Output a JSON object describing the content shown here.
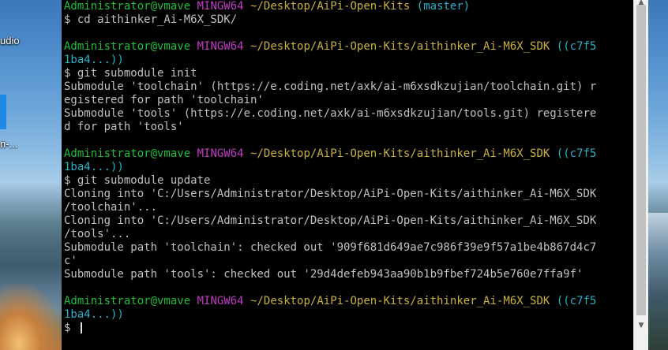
{
  "desktop": {
    "icon_labels": [
      "udio",
      "n-..."
    ]
  },
  "terminal": {
    "lines": [
      {
        "type": "prompt",
        "user": "Administrator@vmave",
        "env": "MINGW64",
        "path": "~/Desktop/AiPi-Open-Kits",
        "branch": "(master)"
      },
      {
        "type": "text",
        "text": "$ cd aithinker_Ai-M6X_SDK/"
      },
      {
        "type": "blank",
        "text": ""
      },
      {
        "type": "prompt",
        "user": "Administrator@vmave",
        "env": "MINGW64",
        "path": "~/Desktop/AiPi-Open-Kits/aithinker_Ai-M6X_SDK",
        "branch": "((c7f5"
      },
      {
        "type": "branchcont",
        "text": "1ba4...))"
      },
      {
        "type": "text",
        "text": "$ git submodule init"
      },
      {
        "type": "text",
        "text": "Submodule 'toolchain' (https://e.coding.net/axk/ai-m6xsdkzujian/toolchain.git) r"
      },
      {
        "type": "text",
        "text": "egistered for path 'toolchain'"
      },
      {
        "type": "text",
        "text": "Submodule 'tools' (https://e.coding.net/axk/ai-m6xsdkzujian/tools.git) registere"
      },
      {
        "type": "text",
        "text": "d for path 'tools'"
      },
      {
        "type": "blank",
        "text": ""
      },
      {
        "type": "prompt",
        "user": "Administrator@vmave",
        "env": "MINGW64",
        "path": "~/Desktop/AiPi-Open-Kits/aithinker_Ai-M6X_SDK",
        "branch": "((c7f5"
      },
      {
        "type": "branchcont",
        "text": "1ba4...))"
      },
      {
        "type": "text",
        "text": "$ git submodule update"
      },
      {
        "type": "text",
        "text": "Cloning into 'C:/Users/Administrator/Desktop/AiPi-Open-Kits/aithinker_Ai-M6X_SDK"
      },
      {
        "type": "text",
        "text": "/toolchain'..."
      },
      {
        "type": "text",
        "text": "Cloning into 'C:/Users/Administrator/Desktop/AiPi-Open-Kits/aithinker_Ai-M6X_SDK"
      },
      {
        "type": "text",
        "text": "/tools'..."
      },
      {
        "type": "text",
        "text": "Submodule path 'toolchain': checked out '909f681d649ae7c986f39e9f57a1be4b867d4c7"
      },
      {
        "type": "text",
        "text": "c'"
      },
      {
        "type": "text",
        "text": "Submodule path 'tools': checked out '29d4defeb943aa90b1b9fbef724b5e760e7ffa9f'"
      },
      {
        "type": "blank",
        "text": ""
      },
      {
        "type": "prompt",
        "user": "Administrator@vmave",
        "env": "MINGW64",
        "path": "~/Desktop/AiPi-Open-Kits/aithinker_Ai-M6X_SDK",
        "branch": "((c7f5"
      },
      {
        "type": "branchcont",
        "text": "1ba4...))"
      },
      {
        "type": "input",
        "text": "$ "
      }
    ]
  },
  "colors": {
    "terminal_bg": "#000000",
    "text": "#c0c0c0",
    "user": "#1fbf3a",
    "mingw": "#c23cc2",
    "path": "#c9b13b",
    "branch": "#2ab0c8"
  },
  "scrollbar": {
    "up_icon": "triangle-up-icon",
    "down_icon": "triangle-down-icon"
  }
}
